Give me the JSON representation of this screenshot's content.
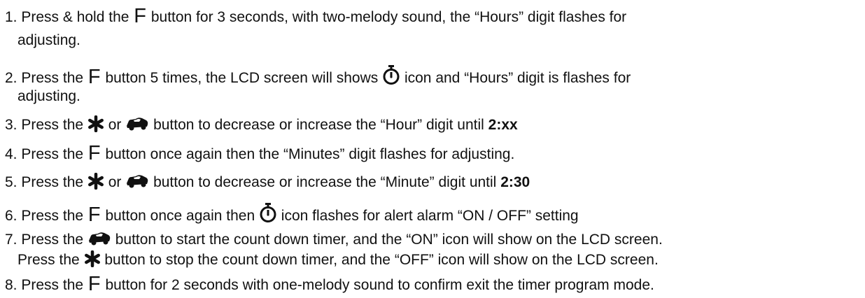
{
  "instructions": {
    "step1": {
      "a": "1. Press & hold the ",
      "f": "F",
      "b": " button for 3 seconds, with two-melody sound, the “Hours” digit flashes for",
      "c": "adjusting."
    },
    "step2": {
      "a": "2. Press the ",
      "f": "F",
      "b": " button 5 times, the LCD screen will shows ",
      "c": " icon and “Hours” digit is flashes for",
      "d": "adjusting."
    },
    "step3": {
      "a": "3. Press the ",
      "b": " or ",
      "c": " button to decrease or increase the “Hour” digit until ",
      "value": "2:xx"
    },
    "step4": {
      "a": "4. Press the ",
      "f": "F",
      "b": " button once again then the “Minutes” digit flashes for adjusting."
    },
    "step5": {
      "a": "5. Press the ",
      "b": " or ",
      "c": " button to decrease or increase the “Minute” digit until ",
      "value": "2:30"
    },
    "step6": {
      "a": "6. Press the ",
      "f": "F",
      "b": " button once again then ",
      "c": " icon flashes for alert alarm “ON / OFF” setting"
    },
    "step7": {
      "a": "7. Press the ",
      "b": " button to start the count down timer, and the “ON” icon will show on the LCD screen.",
      "c": "Press the ",
      "d": " button to stop the count down timer, and the “OFF” icon will show on the LCD screen."
    },
    "step8": {
      "a": "8. Press the ",
      "f": "F",
      "b": " button for 2 seconds with one-melody sound to confirm exit the timer program mode."
    }
  },
  "icons": {
    "timer": "stopwatch-icon",
    "lock": "asterisk-icon",
    "unlock": "car-icon"
  }
}
